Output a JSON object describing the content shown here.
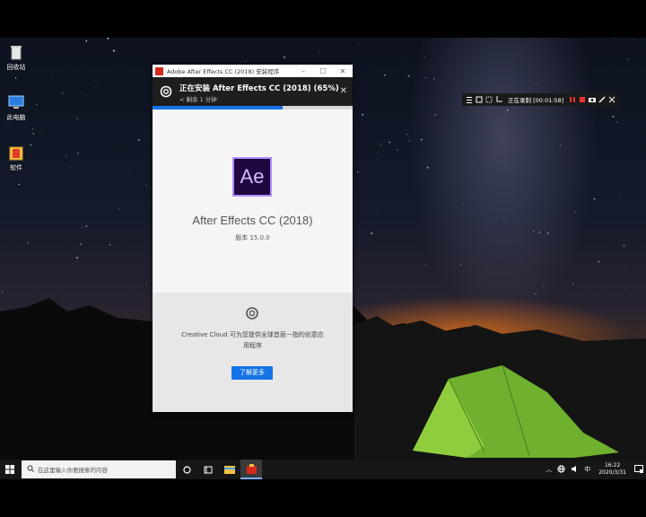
{
  "desktop": {
    "icons": [
      {
        "label": "回收站",
        "icon": "recycle-bin-icon"
      },
      {
        "label": "此电脑",
        "icon": "computer-icon"
      },
      {
        "label": "软件",
        "icon": "folder-icon"
      }
    ]
  },
  "installer": {
    "window_title": "Adobe After Effects CC (2018) 安装程序",
    "status": "正在安装 After Effects CC (2018) (65%)",
    "remaining": "< 剩余 1 分钟",
    "progress_percent": 65,
    "logo_text": "Ae",
    "product_name": "After Effects CC (2018)",
    "version": "版本 15.0.0",
    "promo_text": "Creative Cloud 可为您提供全球首屈一指的创意应用程序",
    "learn_more": "了解更多",
    "colors": {
      "accent": "#1473e6",
      "ae_bg": "#1f0740",
      "ae_border": "#b28bff"
    }
  },
  "recorder": {
    "status_text": "正在录制 [00:01:58]"
  },
  "taskbar": {
    "search_placeholder": "在这里输入你要搜索的内容",
    "tray_ime": "中",
    "time": "16:22",
    "date": "2020/3/31"
  }
}
